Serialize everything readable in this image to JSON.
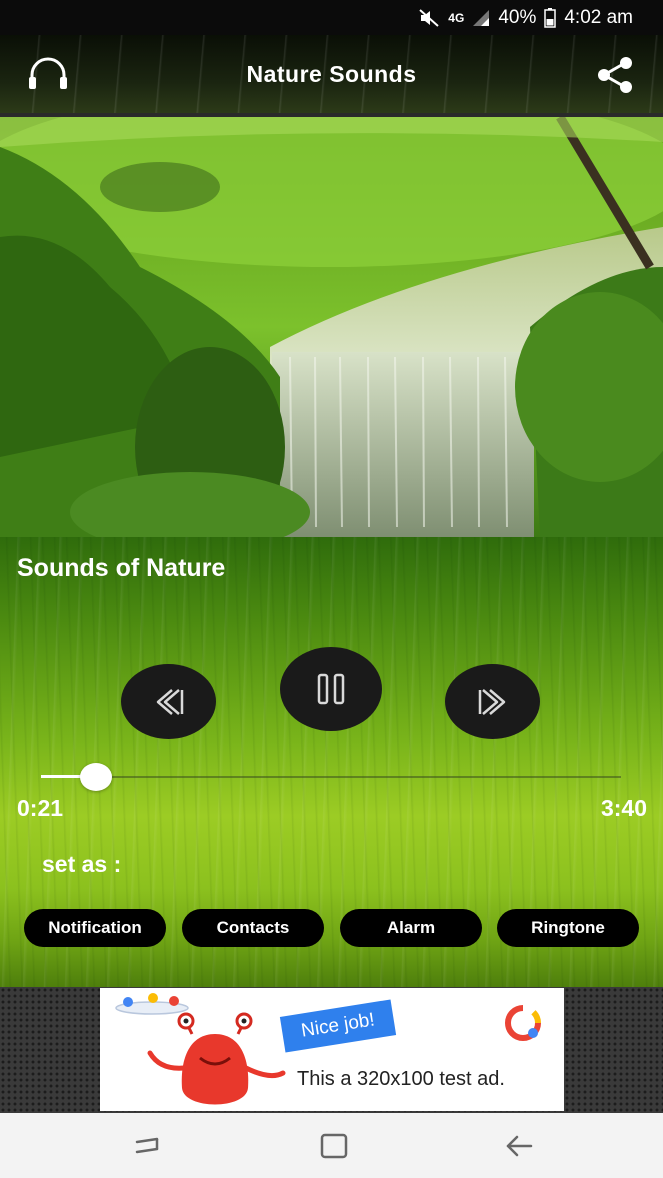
{
  "status_bar": {
    "network": "4G",
    "battery": "40%",
    "time": "4:02 am",
    "icons": [
      "mute-icon",
      "signal-icon",
      "battery-icon"
    ]
  },
  "header": {
    "title": "Nature Sounds",
    "left_icon": "headphones-icon",
    "right_icon": "share-icon"
  },
  "hero": {
    "image": "waterfall-scene"
  },
  "player": {
    "track_title": "Sounds of Nature",
    "controls": [
      "previous-icon",
      "pause-icon",
      "next-icon"
    ],
    "current_time": "0:21",
    "total_time": "3:40",
    "progress": 0.095,
    "set_as_label": "set as :",
    "set_as_options": [
      "Notification",
      "Contacts",
      "Alarm",
      "Ringtone"
    ]
  },
  "ad": {
    "badge": "Nice job!",
    "text": "This a 320x100 test ad."
  },
  "nav": {
    "buttons": [
      "recents-icon",
      "home-icon",
      "back-icon"
    ]
  },
  "colors": {
    "accent": "#8cc11e",
    "control_bg": "#1a1a1a",
    "ad_badge": "#2f80ed"
  }
}
